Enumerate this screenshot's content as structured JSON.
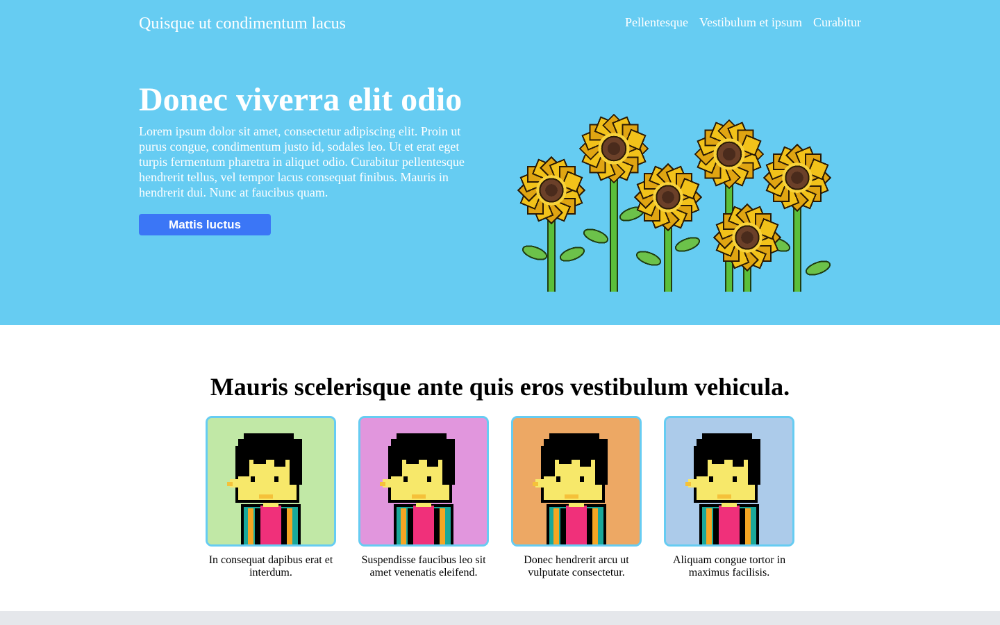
{
  "header": {
    "site_title": "Quisque ut condimentum lacus",
    "nav": [
      "Pellentesque",
      "Vestibulum et ipsum",
      "Curabitur"
    ]
  },
  "hero": {
    "heading": "Donec viverra elit odio",
    "text": "Lorem ipsum dolor sit amet, consectetur adipiscing elit. Proin ut purus congue, condimentum justo id, sodales leo. Ut et erat eget turpis fermentum pharetra in aliquet odio. Curabitur pellentesque hendrerit tellus, vel tempor lacus consequat finibus. Mauris in hendrerit dui. Nunc at faucibus quam.",
    "button_label": "Mattis luctus",
    "background_color": "#66ccf2",
    "button_color": "#3b76f6",
    "image": "pixel-art-sunflowers"
  },
  "section": {
    "heading": "Mauris scelerisque ante quis eros vestibulum vehicula.",
    "cards": [
      {
        "caption": "In consequat dapibus erat et interdum.",
        "bg": "#c1e8a6",
        "image": "pixel-art-avatar"
      },
      {
        "caption": "Suspendisse faucibus leo sit amet venenatis eleifend.",
        "bg": "#e196dd",
        "image": "pixel-art-avatar"
      },
      {
        "caption": "Donec hendrerit arcu ut vulputate consectetur.",
        "bg": "#eda864",
        "image": "pixel-art-avatar"
      },
      {
        "caption": "Aliquam congue tortor in maximus facilisis.",
        "bg": "#accbea",
        "image": "pixel-art-avatar"
      }
    ]
  }
}
